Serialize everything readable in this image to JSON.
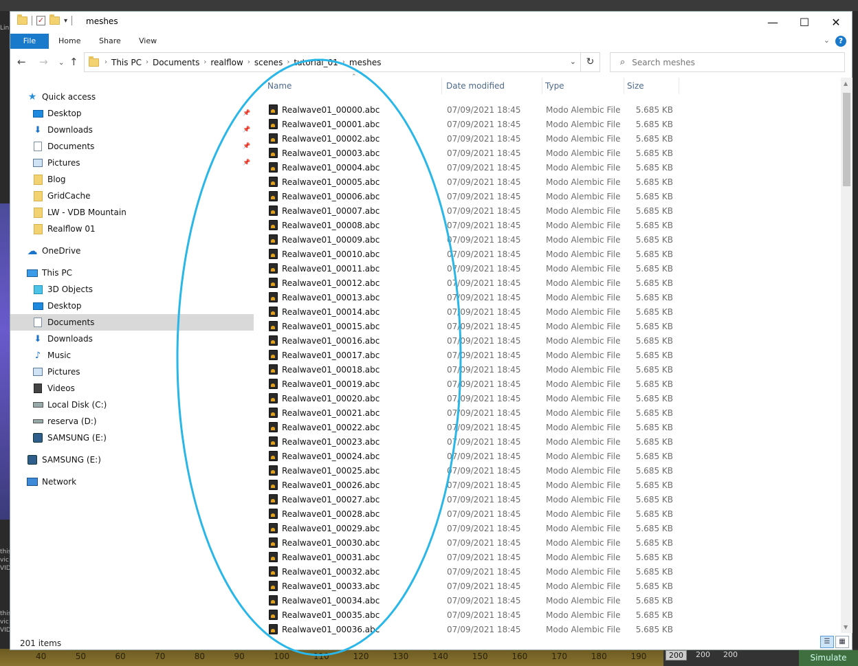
{
  "background": {
    "left_text": [
      "Lin",
      "this",
      "vic",
      "VID",
      "this",
      "vic",
      "VID"
    ],
    "timeline": {
      "ticks": [
        "40",
        "50",
        "60",
        "70",
        "80",
        "90",
        "100",
        "110",
        "120",
        "130",
        "140",
        "150",
        "160",
        "170",
        "180",
        "190"
      ],
      "frames": [
        "200",
        "200",
        "200"
      ],
      "simulate_label": "Simulate"
    }
  },
  "window": {
    "title": "meshes",
    "controls": {
      "minimize": "—",
      "maximize": "☐",
      "close": "✕"
    }
  },
  "ribbon": {
    "tabs": [
      "File",
      "Home",
      "Share",
      "View"
    ],
    "help": "?"
  },
  "address": {
    "crumbs": [
      "This PC",
      "Documents",
      "realflow",
      "scenes",
      "tutorial_01",
      "meshes"
    ],
    "search_placeholder": "Search meshes"
  },
  "nav": {
    "items": [
      {
        "label": "Quick access",
        "icon": "star-icon",
        "level": 0,
        "pinned": false
      },
      {
        "label": "Desktop",
        "icon": "desktop-icon",
        "level": 1,
        "pinned": true
      },
      {
        "label": "Downloads",
        "icon": "downloads-icon",
        "level": 1,
        "pinned": true
      },
      {
        "label": "Documents",
        "icon": "documents-icon",
        "level": 1,
        "pinned": true
      },
      {
        "label": "Pictures",
        "icon": "pictures-icon",
        "level": 1,
        "pinned": true
      },
      {
        "label": "Blog",
        "icon": "folder-icon",
        "level": 1,
        "pinned": false
      },
      {
        "label": "GridCache",
        "icon": "folder-icon",
        "level": 1,
        "pinned": false
      },
      {
        "label": "LW - VDB Mountain",
        "icon": "folder-icon",
        "level": 1,
        "pinned": false
      },
      {
        "label": "Realflow 01",
        "icon": "folder-icon",
        "level": 1,
        "pinned": false
      },
      {
        "label": "OneDrive",
        "icon": "cloud-icon",
        "level": 0,
        "pinned": false
      },
      {
        "label": "This PC",
        "icon": "pc-icon",
        "level": 0,
        "pinned": false
      },
      {
        "label": "3D Objects",
        "icon": "cube-icon",
        "level": 1,
        "pinned": false
      },
      {
        "label": "Desktop",
        "icon": "desktop-icon",
        "level": 1,
        "pinned": false
      },
      {
        "label": "Documents",
        "icon": "documents-icon",
        "level": 1,
        "pinned": false,
        "selected": true
      },
      {
        "label": "Downloads",
        "icon": "downloads-icon",
        "level": 1,
        "pinned": false
      },
      {
        "label": "Music",
        "icon": "music-icon",
        "level": 1,
        "pinned": false
      },
      {
        "label": "Pictures",
        "icon": "pictures-icon",
        "level": 1,
        "pinned": false
      },
      {
        "label": "Videos",
        "icon": "videos-icon",
        "level": 1,
        "pinned": false
      },
      {
        "label": "Local Disk (C:)",
        "icon": "disk-icon",
        "level": 1,
        "pinned": false
      },
      {
        "label": "reserva (D:)",
        "icon": "drive-icon",
        "level": 1,
        "pinned": false
      },
      {
        "label": "SAMSUNG (E:)",
        "icon": "usb-drive-icon",
        "level": 1,
        "pinned": false
      },
      {
        "label": "SAMSUNG (E:)",
        "icon": "usb-drive-icon",
        "level": 0,
        "pinned": false
      },
      {
        "label": "Network",
        "icon": "network-icon",
        "level": 0,
        "pinned": false
      }
    ]
  },
  "list": {
    "columns": [
      "Name",
      "Date modified",
      "Type",
      "Size"
    ],
    "files": [
      {
        "name": "Realwave01_00000.abc",
        "date": "07/09/2021 18:45",
        "type": "Modo Alembic File",
        "size": "5.685 KB"
      },
      {
        "name": "Realwave01_00001.abc",
        "date": "07/09/2021 18:45",
        "type": "Modo Alembic File",
        "size": "5.685 KB"
      },
      {
        "name": "Realwave01_00002.abc",
        "date": "07/09/2021 18:45",
        "type": "Modo Alembic File",
        "size": "5.685 KB"
      },
      {
        "name": "Realwave01_00003.abc",
        "date": "07/09/2021 18:45",
        "type": "Modo Alembic File",
        "size": "5.685 KB"
      },
      {
        "name": "Realwave01_00004.abc",
        "date": "07/09/2021 18:45",
        "type": "Modo Alembic File",
        "size": "5.685 KB"
      },
      {
        "name": "Realwave01_00005.abc",
        "date": "07/09/2021 18:45",
        "type": "Modo Alembic File",
        "size": "5.685 KB"
      },
      {
        "name": "Realwave01_00006.abc",
        "date": "07/09/2021 18:45",
        "type": "Modo Alembic File",
        "size": "5.685 KB"
      },
      {
        "name": "Realwave01_00007.abc",
        "date": "07/09/2021 18:45",
        "type": "Modo Alembic File",
        "size": "5.685 KB"
      },
      {
        "name": "Realwave01_00008.abc",
        "date": "07/09/2021 18:45",
        "type": "Modo Alembic File",
        "size": "5.685 KB"
      },
      {
        "name": "Realwave01_00009.abc",
        "date": "07/09/2021 18:45",
        "type": "Modo Alembic File",
        "size": "5.685 KB"
      },
      {
        "name": "Realwave01_00010.abc",
        "date": "07/09/2021 18:45",
        "type": "Modo Alembic File",
        "size": "5.685 KB"
      },
      {
        "name": "Realwave01_00011.abc",
        "date": "07/09/2021 18:45",
        "type": "Modo Alembic File",
        "size": "5.685 KB"
      },
      {
        "name": "Realwave01_00012.abc",
        "date": "07/09/2021 18:45",
        "type": "Modo Alembic File",
        "size": "5.685 KB"
      },
      {
        "name": "Realwave01_00013.abc",
        "date": "07/09/2021 18:45",
        "type": "Modo Alembic File",
        "size": "5.685 KB"
      },
      {
        "name": "Realwave01_00014.abc",
        "date": "07/09/2021 18:45",
        "type": "Modo Alembic File",
        "size": "5.685 KB"
      },
      {
        "name": "Realwave01_00015.abc",
        "date": "07/09/2021 18:45",
        "type": "Modo Alembic File",
        "size": "5.685 KB"
      },
      {
        "name": "Realwave01_00016.abc",
        "date": "07/09/2021 18:45",
        "type": "Modo Alembic File",
        "size": "5.685 KB"
      },
      {
        "name": "Realwave01_00017.abc",
        "date": "07/09/2021 18:45",
        "type": "Modo Alembic File",
        "size": "5.685 KB"
      },
      {
        "name": "Realwave01_00018.abc",
        "date": "07/09/2021 18:45",
        "type": "Modo Alembic File",
        "size": "5.685 KB"
      },
      {
        "name": "Realwave01_00019.abc",
        "date": "07/09/2021 18:45",
        "type": "Modo Alembic File",
        "size": "5.685 KB"
      },
      {
        "name": "Realwave01_00020.abc",
        "date": "07/09/2021 18:45",
        "type": "Modo Alembic File",
        "size": "5.685 KB"
      },
      {
        "name": "Realwave01_00021.abc",
        "date": "07/09/2021 18:45",
        "type": "Modo Alembic File",
        "size": "5.685 KB"
      },
      {
        "name": "Realwave01_00022.abc",
        "date": "07/09/2021 18:45",
        "type": "Modo Alembic File",
        "size": "5.685 KB"
      },
      {
        "name": "Realwave01_00023.abc",
        "date": "07/09/2021 18:45",
        "type": "Modo Alembic File",
        "size": "5.685 KB"
      },
      {
        "name": "Realwave01_00024.abc",
        "date": "07/09/2021 18:45",
        "type": "Modo Alembic File",
        "size": "5.685 KB"
      },
      {
        "name": "Realwave01_00025.abc",
        "date": "07/09/2021 18:45",
        "type": "Modo Alembic File",
        "size": "5.685 KB"
      },
      {
        "name": "Realwave01_00026.abc",
        "date": "07/09/2021 18:45",
        "type": "Modo Alembic File",
        "size": "5.685 KB"
      },
      {
        "name": "Realwave01_00027.abc",
        "date": "07/09/2021 18:45",
        "type": "Modo Alembic File",
        "size": "5.685 KB"
      },
      {
        "name": "Realwave01_00028.abc",
        "date": "07/09/2021 18:45",
        "type": "Modo Alembic File",
        "size": "5.685 KB"
      },
      {
        "name": "Realwave01_00029.abc",
        "date": "07/09/2021 18:45",
        "type": "Modo Alembic File",
        "size": "5.685 KB"
      },
      {
        "name": "Realwave01_00030.abc",
        "date": "07/09/2021 18:45",
        "type": "Modo Alembic File",
        "size": "5.685 KB"
      },
      {
        "name": "Realwave01_00031.abc",
        "date": "07/09/2021 18:45",
        "type": "Modo Alembic File",
        "size": "5.685 KB"
      },
      {
        "name": "Realwave01_00032.abc",
        "date": "07/09/2021 18:45",
        "type": "Modo Alembic File",
        "size": "5.685 KB"
      },
      {
        "name": "Realwave01_00033.abc",
        "date": "07/09/2021 18:45",
        "type": "Modo Alembic File",
        "size": "5.685 KB"
      },
      {
        "name": "Realwave01_00034.abc",
        "date": "07/09/2021 18:45",
        "type": "Modo Alembic File",
        "size": "5.685 KB"
      },
      {
        "name": "Realwave01_00035.abc",
        "date": "07/09/2021 18:45",
        "type": "Modo Alembic File",
        "size": "5.685 KB"
      },
      {
        "name": "Realwave01_00036.abc",
        "date": "07/09/2021 18:45",
        "type": "Modo Alembic File",
        "size": "5.685 KB"
      }
    ]
  },
  "status": {
    "item_count": "201 items"
  },
  "colors": {
    "accent": "#1979ca",
    "selection": "#d9d9d9",
    "annotation": "#29b6e8"
  }
}
